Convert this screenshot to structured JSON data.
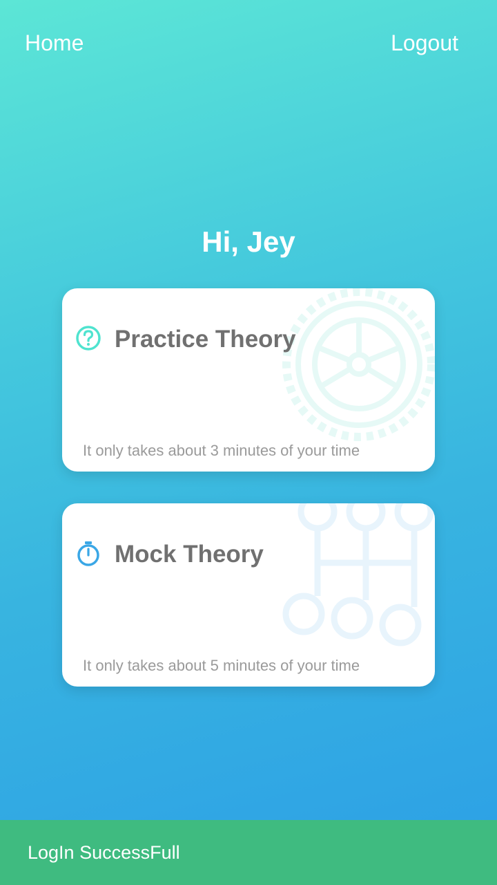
{
  "nav": {
    "home_label": "Home",
    "logout_label": "Logout"
  },
  "greeting": "Hi, Jey",
  "cards": [
    {
      "title": "Practice Theory",
      "subtitle": "It only takes about 3 minutes of your time",
      "icon": "question-circle-icon",
      "bg_icon": "tire-icon",
      "icon_color": "#4fe3cf"
    },
    {
      "title": "Mock Theory",
      "subtitle": "It only takes about 5 minutes of your time",
      "icon": "stopwatch-icon",
      "bg_icon": "gear-shift-icon",
      "icon_color": "#3aa7e6"
    }
  ],
  "snackbar": {
    "message": "LogIn SuccessFull",
    "color": "#3fbb80"
  },
  "colors": {
    "gradient_start": "#5ce6d6",
    "gradient_end": "#2c9fe6"
  }
}
